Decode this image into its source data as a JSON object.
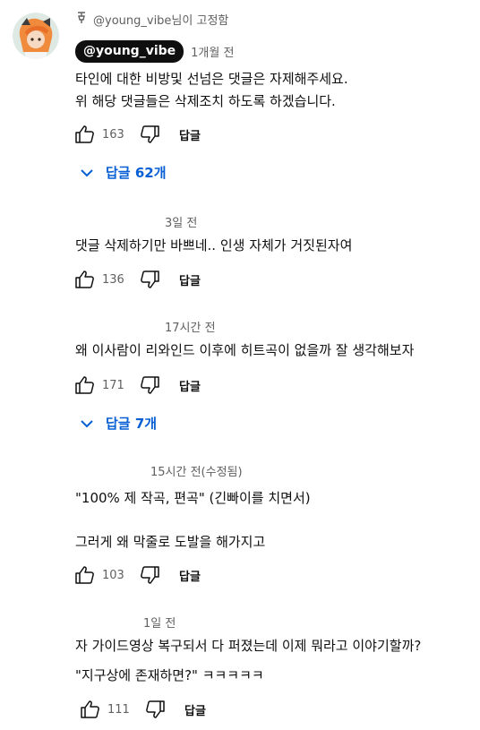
{
  "pinned": {
    "pin_label": "@young_vibe님이 고정함",
    "author": "@young_vibe",
    "time": "1개월 전",
    "lines": [
      "타인에 대한 비방및 선넘은 댓글은 자제해주세요.",
      "위 해당 댓글들은 삭제조치 하도록 하겠습니다."
    ],
    "likes": "163",
    "reply_label": "답글",
    "replies_toggle": "답글 62개"
  },
  "comments": [
    {
      "time": "3일 전",
      "lines": [
        "댓글 삭제하기만 바쁘네.. 인생 자체가 거짓된자여"
      ],
      "likes": "136",
      "reply_label": "답글"
    },
    {
      "time": "17시간 전",
      "lines": [
        "왜 이사람이 리와인드 이후에 히트곡이 없을까 잘 생각해보자"
      ],
      "likes": "171",
      "reply_label": "답글",
      "replies_toggle": "답글 7개"
    },
    {
      "time": "15시간 전(수정됨)",
      "lines": [
        "\"100% 제 작곡, 편곡\" (긴빠이를 치면서)",
        "그러게 왜 막줄로 도발을 해가지고"
      ],
      "likes": "103",
      "reply_label": "답글"
    },
    {
      "time": "1일 전",
      "lines": [
        "자 가이드영상 복구되서 다 퍼졌는데 이제 뭐라고 이야기할까?",
        "\"지구상에 존재하면?\" ㅋㅋㅋㅋㅋ"
      ],
      "likes": "111",
      "reply_label": "답글"
    }
  ],
  "colors": {
    "link": "#065fd4",
    "meta": "#606060",
    "text": "#0f0f0f"
  },
  "icons": [
    "pin-icon",
    "thumbs-up-icon",
    "thumbs-down-icon",
    "chevron-down-icon"
  ]
}
